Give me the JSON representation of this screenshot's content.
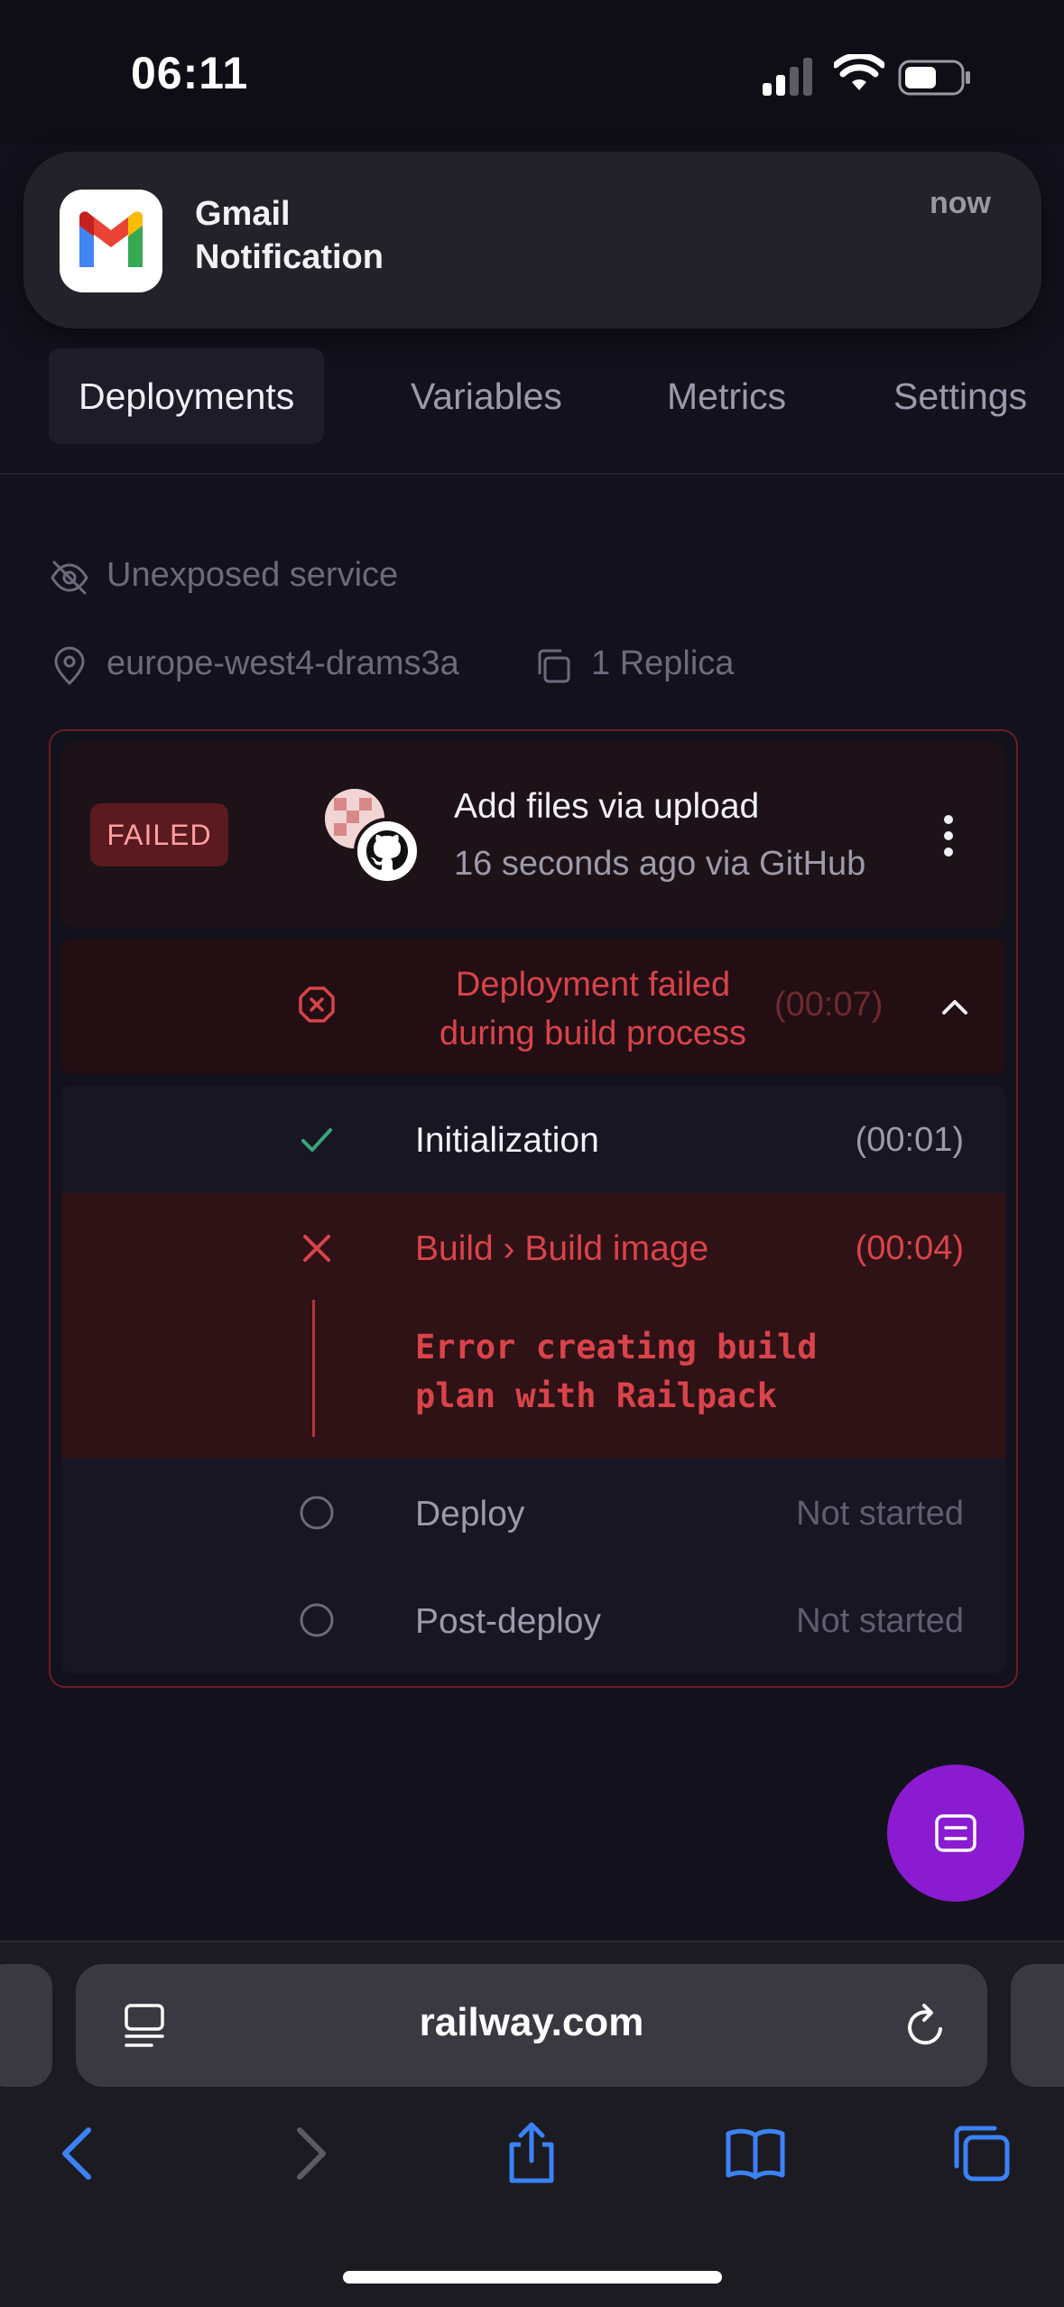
{
  "status_bar": {
    "time": "06:11"
  },
  "notification": {
    "app": "Gmail",
    "body": "Notification",
    "time": "now",
    "icon": "gmail-icon"
  },
  "tabs": [
    {
      "label": "Deployments",
      "active": true
    },
    {
      "label": "Variables"
    },
    {
      "label": "Metrics"
    },
    {
      "label": "Settings"
    }
  ],
  "service": {
    "exposure": "Unexposed service",
    "region": "europe-west4-drams3a",
    "replicas": "1 Replica"
  },
  "deployment": {
    "status": "FAILED",
    "commit_title": "Add files via upload",
    "commit_meta": "16 seconds ago via GitHub",
    "failure_line1": "Deployment failed",
    "failure_line2": "during build process",
    "failure_time": "(00:07)",
    "steps": [
      {
        "label": "Initialization",
        "time": "(00:01)",
        "state": "success"
      },
      {
        "label": "Build › Build image",
        "time": "(00:04)",
        "state": "error",
        "error_line1": "Error creating build",
        "error_line2": "plan with Railpack"
      },
      {
        "label": "Deploy",
        "time": "Not started",
        "state": "pending"
      },
      {
        "label": "Post-deploy",
        "time": "Not started",
        "state": "pending"
      }
    ]
  },
  "browser": {
    "url": "railway.com"
  },
  "colors": {
    "accent_fab": "#8a1bd1",
    "error": "#d9434a",
    "success": "#3aa57a",
    "ios_blue": "#3b82f6"
  }
}
